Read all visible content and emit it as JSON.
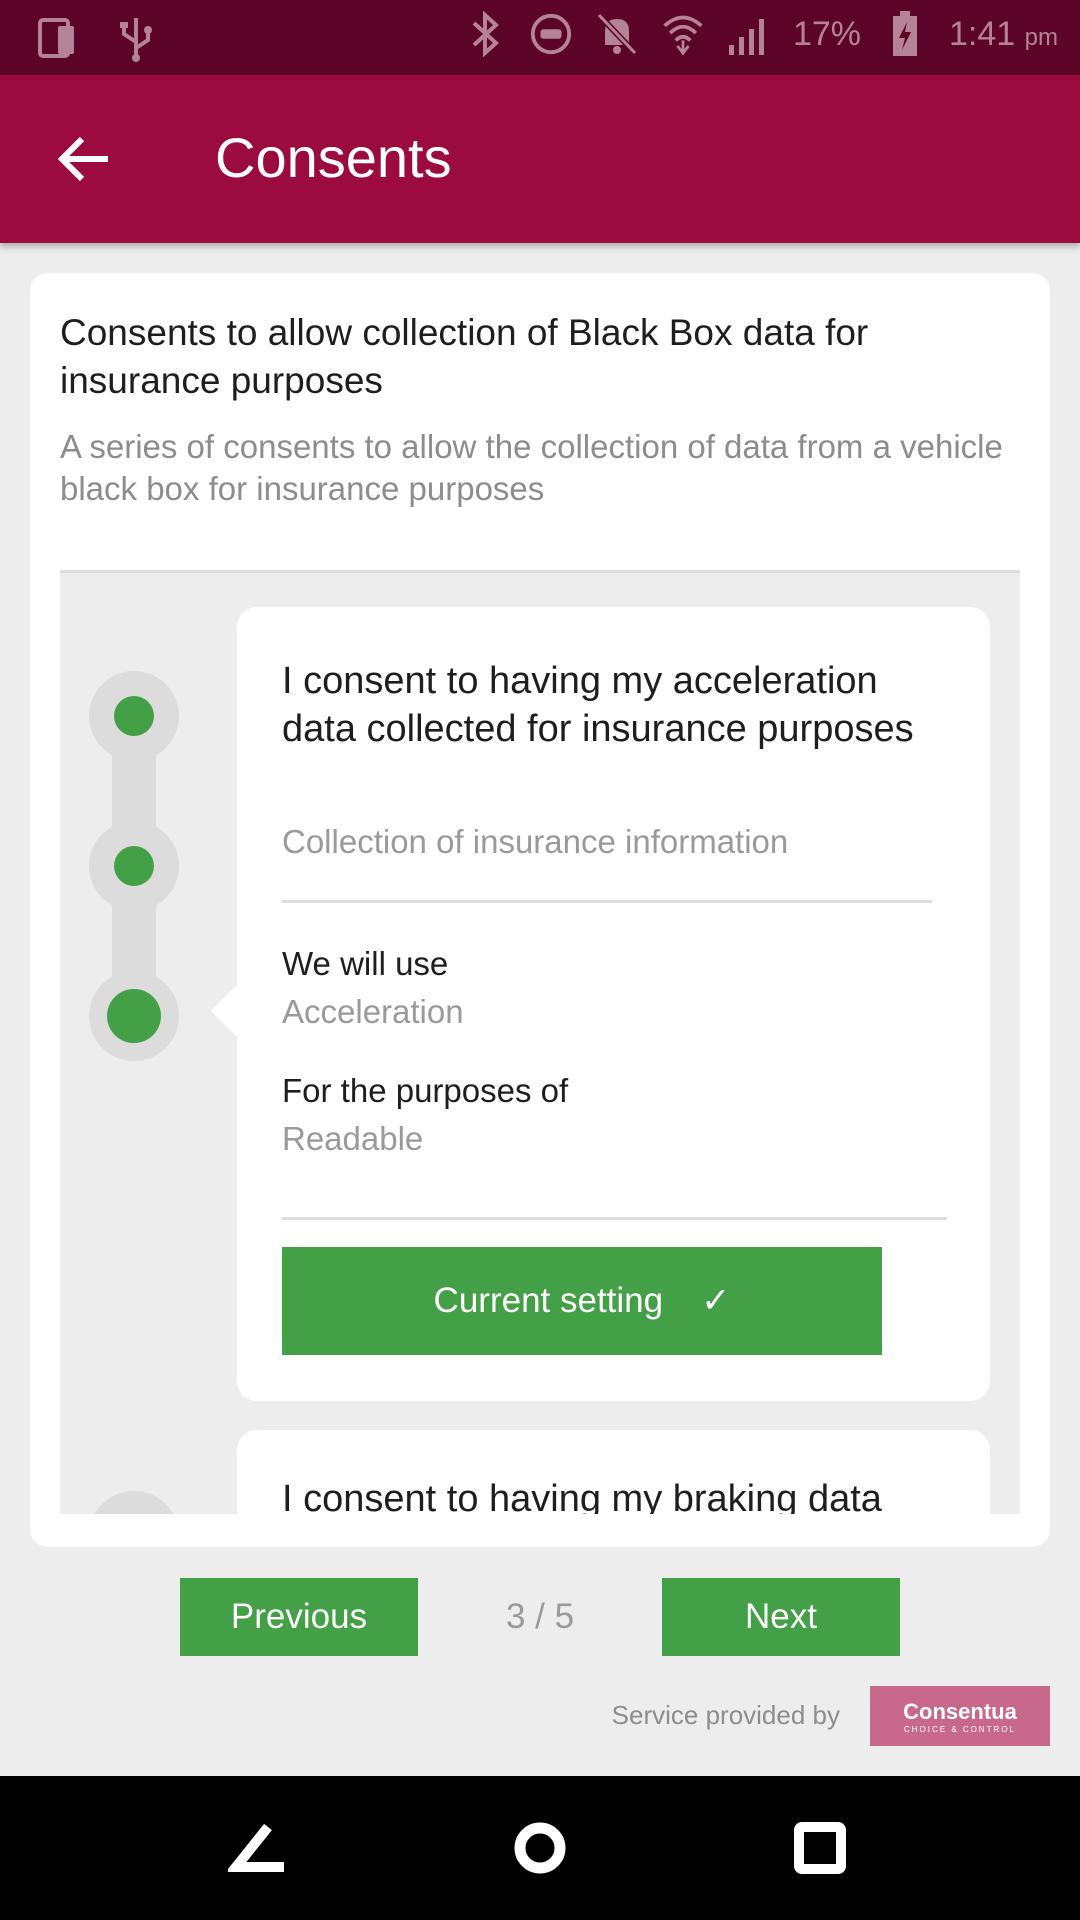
{
  "status_bar": {
    "battery": "17%",
    "time": "1:41",
    "ampm": "pm",
    "icons_left": [
      "device-icon",
      "usb-icon"
    ],
    "icons_right": [
      "bluetooth-icon",
      "dnd-icon",
      "bell-off-icon",
      "wifi-icon",
      "signal-icon",
      "battery-charging-icon"
    ]
  },
  "app_bar": {
    "title": "Consents"
  },
  "card": {
    "title": "Consents to allow collection of Black Box data for insurance purposes",
    "subtitle": "A series of consents to allow the collection of data from a vehicle black box for insurance purposes"
  },
  "consent": {
    "title": "I consent to having my acceleration data collected for insurance purposes",
    "subtitle": "Collection of insurance information",
    "use_label": "We will use",
    "use_value": "Acceleration",
    "purpose_label": "For the purposes of",
    "purpose_value": "Readable",
    "button_label": "Current setting",
    "button_check": "✓"
  },
  "next_consent": {
    "title": "I consent to having my braking data"
  },
  "pager": {
    "previous": "Previous",
    "count": "3 / 5",
    "next": "Next"
  },
  "footer": {
    "provided_by": "Service provided by",
    "logo_text": "Consentua",
    "logo_tagline": "CHOICE & CONTROL"
  },
  "colors": {
    "status_bar": "#5d0529",
    "app_bar": "#9c0b40",
    "accent_green": "#43a047",
    "logo_bg": "#c8698c"
  }
}
